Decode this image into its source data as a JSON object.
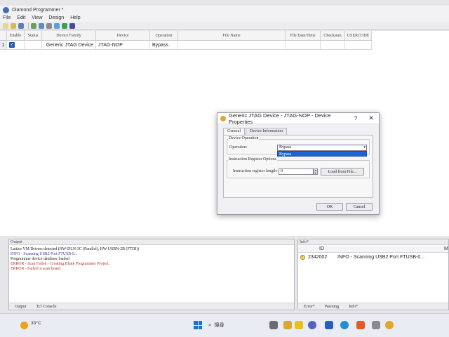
{
  "window": {
    "title": "Diamond Programmer *"
  },
  "menu": [
    "File",
    "Edit",
    "View",
    "Design",
    "Help"
  ],
  "grid": {
    "columns": [
      "Enable",
      "Status",
      "Device Family",
      "Device",
      "Operation",
      "File Name",
      "File Date/Time",
      "Checksum",
      "USERCODE"
    ],
    "rows": [
      {
        "num": "1",
        "enable": "✓",
        "status": "",
        "family": "Generic JTAG Device",
        "device": "JTAG-NOP",
        "operation": "Bypass",
        "file": "",
        "date": "",
        "checksum": "",
        "usercode": ""
      }
    ]
  },
  "dialog": {
    "title": "Generic JTAG Device - JTAG-NOP - Device Properties",
    "help": "?",
    "close": "✕",
    "tabs": [
      "General",
      "Device Information"
    ],
    "group_operation": "Device Operation",
    "operation_label": "Operation:",
    "operation_value": "Bypass",
    "dropdown_highlight": "Bypass",
    "group_ir": "Instruction Register Options",
    "ir_label": "Instruction register length:",
    "ir_value": "0",
    "load_button": "Load from File...",
    "ok": "OK",
    "cancel": "Cancel"
  },
  "output": {
    "title": "Output",
    "lines": [
      {
        "text": "Lattice VM Drivers detected (HW-DLN-3C (Parallel), HW-USBN-2B (FTDI))",
        "color": "#1a1a1a"
      },
      {
        "text": "INFO - Scanning USB2 Port FTUSB-0...",
        "color": "#3a3aa8"
      },
      {
        "text": "Programmer device database loaded",
        "color": "#1a1a1a"
      },
      {
        "text": "ERROR - Scan Failed - Creating Blank Programmer Project.",
        "color": "#b03030"
      },
      {
        "text": "ERROR - Failed to scan board.",
        "color": "#b03030"
      }
    ],
    "tabs": [
      "Output",
      "Tcl Console"
    ]
  },
  "info": {
    "title": "Info*",
    "col_id": "ID",
    "col_m": "M",
    "row_id": "2342002",
    "row_msg": "INFO - Scanning USB2 Port FTUSB-0...",
    "row_icon": "i",
    "tabs": [
      "Error*",
      "Warning",
      "Info*"
    ]
  },
  "taskbar": {
    "temperature": "33°C",
    "search": "搜尋"
  },
  "colors": {
    "accent": "#1e63d1",
    "error": "#b03030",
    "info": "#3a3aa8"
  }
}
